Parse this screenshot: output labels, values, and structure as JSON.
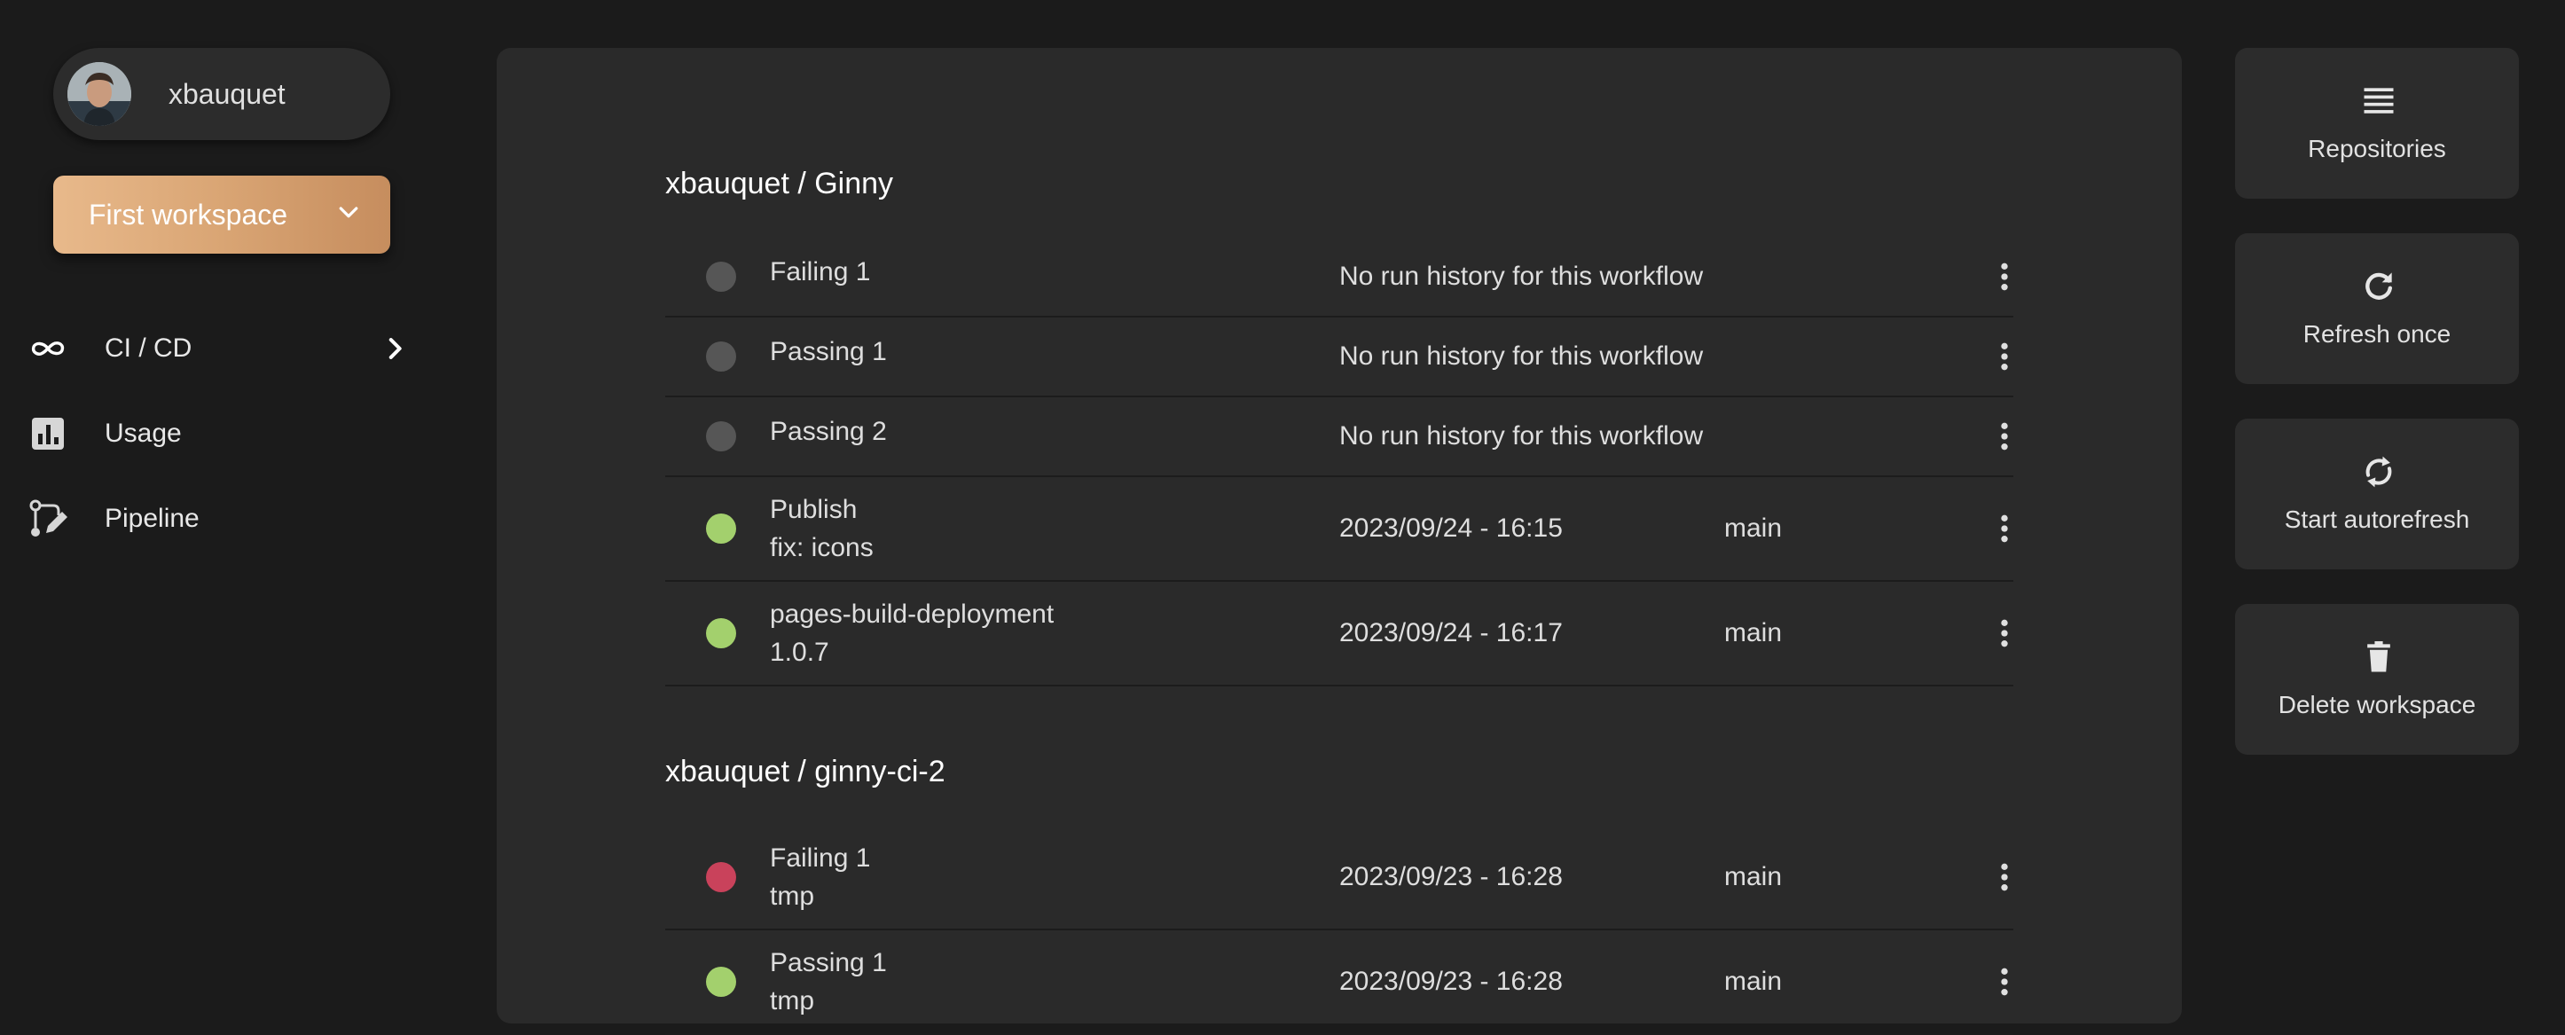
{
  "user": {
    "name": "xbauquet"
  },
  "workspace": {
    "label": "First workspace"
  },
  "nav": [
    {
      "label": "CI / CD",
      "icon": "infinity-icon",
      "has_chevron": true
    },
    {
      "label": "Usage",
      "icon": "bar-chart-icon"
    },
    {
      "label": "Pipeline",
      "icon": "pipeline-icon"
    }
  ],
  "actions": [
    {
      "label": "Repositories",
      "icon": "list-icon"
    },
    {
      "label": "Refresh once",
      "icon": "refresh-icon"
    },
    {
      "label": "Start autorefresh",
      "icon": "sync-icon"
    },
    {
      "label": "Delete workspace",
      "icon": "trash-icon"
    }
  ],
  "colors": {
    "none": "#565656",
    "success": "#a3d06d",
    "failure": "#c9425b",
    "accent_gradient_start": "#e8b98b",
    "accent_gradient_end": "#c68d5e"
  },
  "repos": [
    {
      "title": "xbauquet / Ginny",
      "workflows": [
        {
          "name": "Failing 1",
          "sub": "",
          "status": "No run history for this workflow",
          "branch": "",
          "state": "none"
        },
        {
          "name": "Passing 1",
          "sub": "",
          "status": "No run history for this workflow",
          "branch": "",
          "state": "none"
        },
        {
          "name": "Passing 2",
          "sub": "",
          "status": "No run history for this workflow",
          "branch": "",
          "state": "none"
        },
        {
          "name": "Publish",
          "sub": "fix: icons",
          "status": "2023/09/24 - 16:15",
          "branch": "main",
          "state": "success"
        },
        {
          "name": "pages-build-deployment",
          "sub": "1.0.7",
          "status": "2023/09/24 - 16:17",
          "branch": "main",
          "state": "success"
        }
      ]
    },
    {
      "title": "xbauquet / ginny-ci-2",
      "workflows": [
        {
          "name": "Failing 1",
          "sub": "tmp",
          "status": "2023/09/23 - 16:28",
          "branch": "main",
          "state": "failure"
        },
        {
          "name": "Passing 1",
          "sub": "tmp",
          "status": "2023/09/23 - 16:28",
          "branch": "main",
          "state": "success"
        }
      ]
    }
  ]
}
